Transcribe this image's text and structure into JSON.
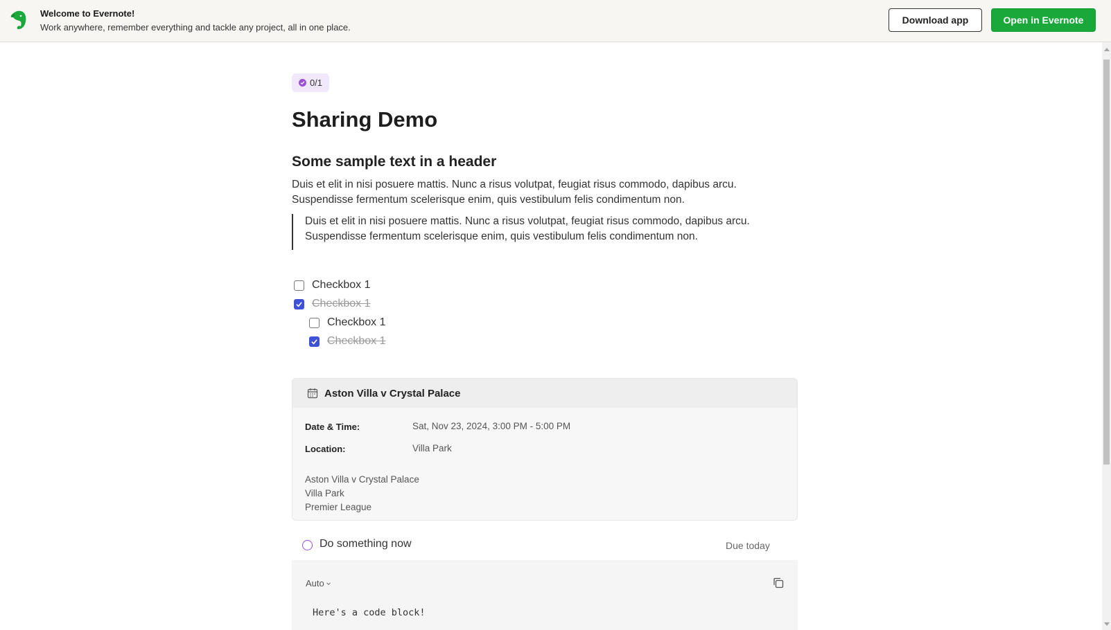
{
  "banner": {
    "title": "Welcome to Evernote!",
    "subtitle": "Work anywhere, remember everything and tackle any project, all in one place.",
    "download_label": "Download app",
    "open_label": "Open in Evernote",
    "accent_color": "#1aa83a"
  },
  "note": {
    "task_counter": "0/1",
    "title": "Sharing Demo",
    "header": "Some sample text in a header",
    "paragraph_lines": [
      "Duis et elit in nisi posuere mattis. Nunc a risus volutpat, feugiat risus commodo, dapibus arcu.",
      "Suspendisse fermentum scelerisque enim, quis vestibulum felis condimentum non."
    ],
    "quote_lines": [
      "Duis et elit in nisi posuere mattis. Nunc a risus volutpat, feugiat risus commodo, dapibus arcu.",
      "Suspendisse fermentum scelerisque enim, quis vestibulum felis condimentum non."
    ],
    "checklist": [
      {
        "label": "Checkbox 1",
        "checked": false,
        "indent": 0
      },
      {
        "label": "Checkbox 1",
        "checked": true,
        "indent": 0
      },
      {
        "label": "Checkbox 1",
        "checked": false,
        "indent": 1
      },
      {
        "label": "Checkbox 1",
        "checked": true,
        "indent": 1
      }
    ]
  },
  "event": {
    "title": "Aston Villa v Crystal Palace",
    "date_label": "Date & Time:",
    "date_value": "Sat, Nov 23, 2024, 3:00 PM - 5:00 PM",
    "location_label": "Location:",
    "location_value": "Villa Park",
    "description_lines": [
      "Aston Villa v Crystal Palace",
      "Villa Park",
      "Premier League"
    ]
  },
  "task": {
    "text": "Do something now",
    "due": "Due today",
    "circle_color": "#9a4fd6"
  },
  "code": {
    "language": "Auto",
    "content": "Here's a code block!"
  },
  "icons": [
    "evernote-logo",
    "task-check-icon",
    "calendar-icon",
    "chevron-down-icon",
    "copy-icon"
  ]
}
